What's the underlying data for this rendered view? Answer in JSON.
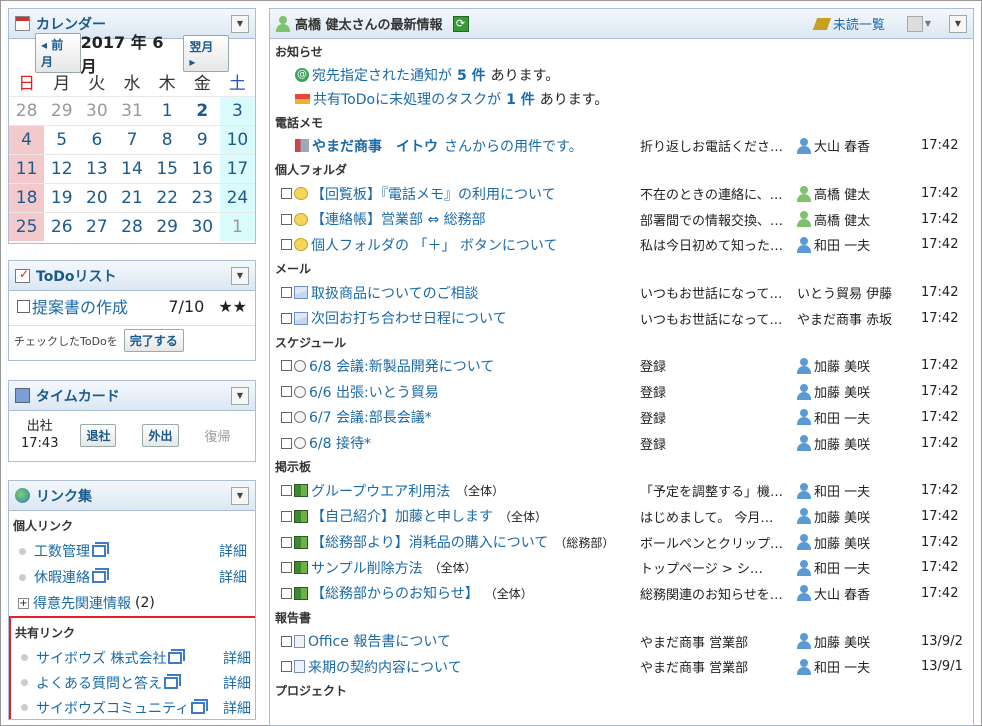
{
  "calendar": {
    "title": "カレンダー",
    "prev": "◂ 前月",
    "month": "2017 年 6 月",
    "next": "翌月 ▸",
    "weekdays": [
      "日",
      "月",
      "火",
      "水",
      "木",
      "金",
      "土"
    ],
    "weeks": [
      [
        "28",
        "29",
        "30",
        "31",
        "1",
        "2",
        "3"
      ],
      [
        "4",
        "5",
        "6",
        "7",
        "8",
        "9",
        "10"
      ],
      [
        "11",
        "12",
        "13",
        "14",
        "15",
        "16",
        "17"
      ],
      [
        "18",
        "19",
        "20",
        "21",
        "22",
        "23",
        "24"
      ],
      [
        "25",
        "26",
        "27",
        "28",
        "29",
        "30",
        "1"
      ]
    ]
  },
  "todo": {
    "title": "ToDoリスト",
    "item": "提案書の作成",
    "date": "7/10",
    "stars": "★★",
    "checked_label": "チェックしたToDoを",
    "complete": "完了する"
  },
  "timecard": {
    "title": "タイムカード",
    "in_label": "出社",
    "in_time": "17:43",
    "leave": "退社",
    "out": "外出",
    "return": "復帰"
  },
  "links": {
    "title": "リンク集",
    "personal": "個人リンク",
    "shared": "共有リンク",
    "detail": "詳細",
    "personal_items": [
      "工数管理",
      "休暇連絡"
    ],
    "group": "得意先関連情報",
    "group_count": "(2)",
    "shared_items": [
      "サイボウズ 株式会社",
      "よくある質問と答え",
      "サイボウズコミュニティ"
    ]
  },
  "main": {
    "title": "高橋 健太さんの最新情報",
    "unread": "未読一覧",
    "notice_label": "お知らせ",
    "notice1": {
      "pre": "宛先指定された通知が",
      "num": "5 件",
      "post": "あります。"
    },
    "notice2": {
      "pre": "共有ToDoに未処理のタスクが",
      "num": "1 件",
      "post": "あります。"
    },
    "sections": [
      {
        "label": "電話メモ",
        "rows": [
          {
            "title": "やまだ商事　イトウ",
            "suffix": "さんからの用件です。",
            "c2": "折り返しお電話くださ…",
            "c3": "大山 春香",
            "c4": "17:42",
            "p": "b",
            "ic": "memo"
          }
        ]
      },
      {
        "label": "個人フォルダ",
        "rows": [
          {
            "title": "【回覧板】『電話メモ』の利用について",
            "c2": "不在のときの連絡に、…",
            "c3": "高橋 健太",
            "c4": "17:42",
            "p": "g",
            "ic": "msg",
            "cb": true
          },
          {
            "title": "【連絡帳】営業部 ⇔ 総務部",
            "c2": "部署間での情報交換、…",
            "c3": "高橋 健太",
            "c4": "17:42",
            "p": "g",
            "ic": "msg",
            "cb": true
          },
          {
            "title": "個人フォルダの 「＋」 ボタンについて",
            "c2": "私は今日初めて知った…",
            "c3": "和田 一夫",
            "c4": "17:42",
            "p": "b",
            "ic": "msg",
            "cb": true
          }
        ]
      },
      {
        "label": "メール",
        "rows": [
          {
            "title": "取扱商品についてのご相談",
            "c2": "いつもお世話になって…",
            "c3": "いとう貿易 伊藤",
            "c4": "17:42",
            "ic": "mail",
            "cb": true
          },
          {
            "title": "次回お打ち合わせ日程について",
            "c2": "いつもお世話になって…",
            "c3": "やまだ商事 赤坂",
            "c4": "17:42",
            "ic": "mail",
            "cb": true
          }
        ]
      },
      {
        "label": "スケジュール",
        "rows": [
          {
            "title": "6/8 会議:新製品開発について",
            "c2": "登録",
            "c3": "加藤 美咲",
            "c4": "17:42",
            "p": "b",
            "ic": "clock",
            "cb": true
          },
          {
            "title": "6/6 出張:いとう貿易",
            "c2": "登録",
            "c3": "加藤 美咲",
            "c4": "17:42",
            "p": "b",
            "ic": "clock",
            "cb": true
          },
          {
            "title": "6/7 会議:部長会議*",
            "c2": "登録",
            "c3": "和田 一夫",
            "c4": "17:42",
            "p": "b",
            "ic": "clock",
            "cb": true
          },
          {
            "title": "6/8 接待*",
            "c2": "登録",
            "c3": "加藤 美咲",
            "c4": "17:42",
            "p": "b",
            "ic": "clock",
            "cb": true
          }
        ]
      },
      {
        "label": "掲示板",
        "rows": [
          {
            "title": "グループウエア利用法",
            "suffix": "（全体）",
            "c2": "「予定を調整する」機…",
            "c3": "和田 一夫",
            "c4": "17:42",
            "p": "b",
            "ic": "board",
            "cb": true
          },
          {
            "title": "【自己紹介】加藤と申します",
            "suffix": "（全体）",
            "c2": "はじめまして。 今月…",
            "c3": "加藤 美咲",
            "c4": "17:42",
            "p": "b",
            "ic": "board",
            "cb": true
          },
          {
            "title": "【総務部より】消耗品の購入について",
            "suffix": "（総務部）",
            "c2": "ボールペンとクリップ…",
            "c3": "加藤 美咲",
            "c4": "17:42",
            "p": "b",
            "ic": "board",
            "cb": true
          },
          {
            "title": "サンプル削除方法",
            "suffix": "（全体）",
            "c2": "トップページ > シ…",
            "c3": "和田 一夫",
            "c4": "17:42",
            "p": "b",
            "ic": "board",
            "cb": true
          },
          {
            "title": "【総務部からのお知らせ】",
            "suffix": "（全体）",
            "c2": "総務関連のお知らせを…",
            "c3": "大山 春香",
            "c4": "17:42",
            "p": "b",
            "ic": "board",
            "cb": true
          }
        ]
      },
      {
        "label": "報告書",
        "rows": [
          {
            "title": "Office 報告書について",
            "c2": "やまだ商事 営業部",
            "c3": "加藤 美咲",
            "c4": "13/9/2",
            "p": "b",
            "ic": "report",
            "cb": true
          },
          {
            "title": "来期の契約内容について",
            "c2": "やまだ商事 営業部",
            "c3": "和田 一夫",
            "c4": "13/9/1",
            "p": "b",
            "ic": "report",
            "cb": true
          }
        ]
      },
      {
        "label": "プロジェクト",
        "rows": []
      }
    ]
  }
}
